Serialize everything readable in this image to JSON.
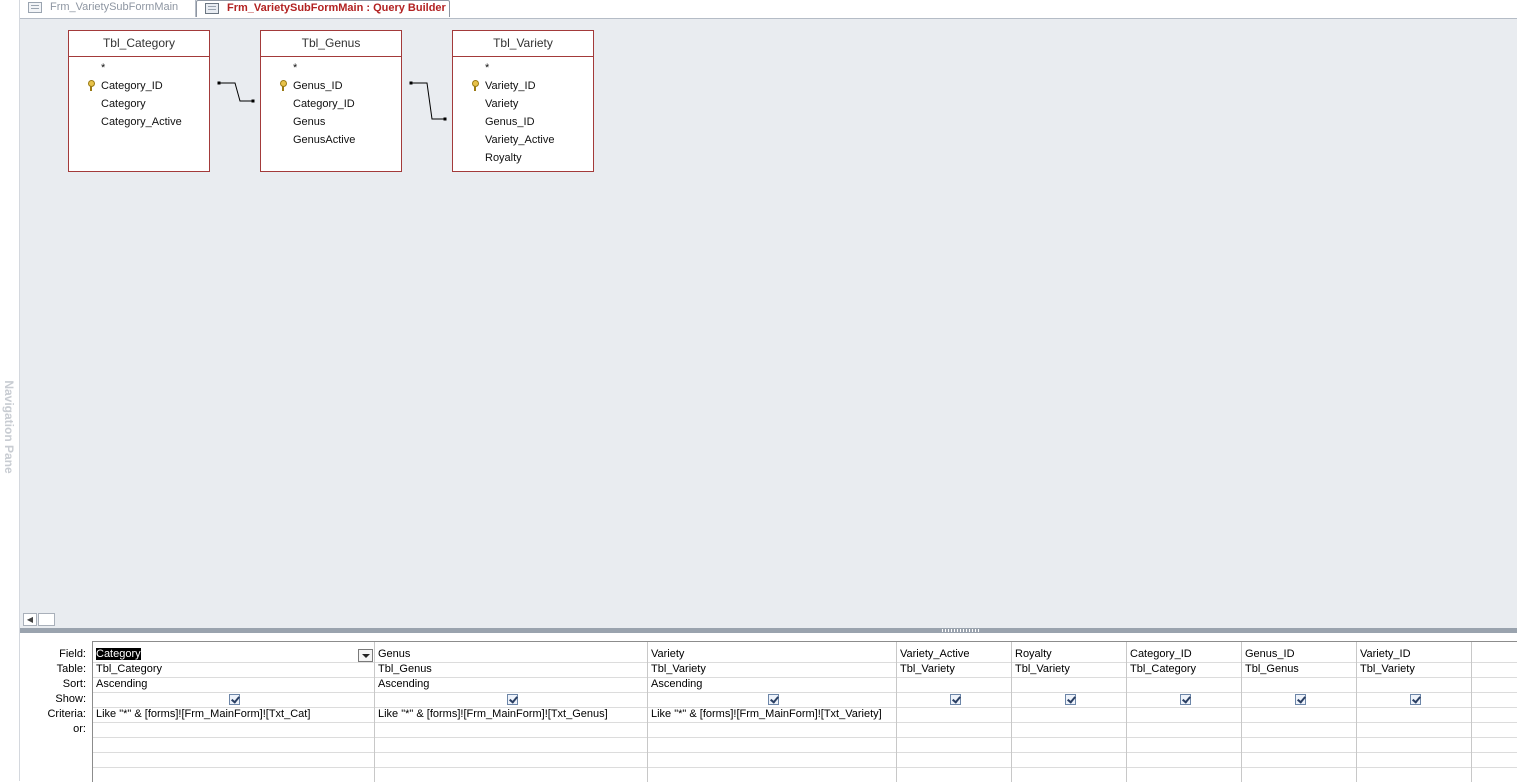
{
  "nav_pane": {
    "label": "Navigation Pane"
  },
  "tabs": [
    {
      "label": "Frm_VarietySubFormMain",
      "active": false
    },
    {
      "label": "Frm_VarietySubFormMain : Query Builder",
      "active": true
    }
  ],
  "tables": [
    {
      "name": "Tbl_Category",
      "fields": [
        "*",
        "Category_ID",
        "Category",
        "Category_Active"
      ],
      "key_field": "Category_ID"
    },
    {
      "name": "Tbl_Genus",
      "fields": [
        "*",
        "Genus_ID",
        "Category_ID",
        "Genus",
        "GenusActive"
      ],
      "key_field": "Genus_ID"
    },
    {
      "name": "Tbl_Variety",
      "fields": [
        "*",
        "Variety_ID",
        "Variety",
        "Genus_ID",
        "Variety_Active",
        "Royalty"
      ],
      "key_field": "Variety_ID"
    }
  ],
  "row_labels": [
    "Field:",
    "Table:",
    "Sort:",
    "Show:",
    "Criteria:",
    "or:"
  ],
  "columns": [
    {
      "field": "Category",
      "table": "Tbl_Category",
      "sort": "Ascending",
      "show": true,
      "criteria": "Like \"*\" & [forms]![Frm_MainForm]![Txt_Cat]"
    },
    {
      "field": "Genus",
      "table": "Tbl_Genus",
      "sort": "Ascending",
      "show": true,
      "criteria": "Like \"*\" & [forms]![Frm_MainForm]![Txt_Genus]"
    },
    {
      "field": "Variety",
      "table": "Tbl_Variety",
      "sort": "Ascending",
      "show": true,
      "criteria": "Like \"*\" & [forms]![Frm_MainForm]![Txt_Variety]"
    },
    {
      "field": "Variety_Active",
      "table": "Tbl_Variety",
      "sort": "",
      "show": true,
      "criteria": ""
    },
    {
      "field": "Royalty",
      "table": "Tbl_Variety",
      "sort": "",
      "show": true,
      "criteria": ""
    },
    {
      "field": "Category_ID",
      "table": "Tbl_Category",
      "sort": "",
      "show": true,
      "criteria": ""
    },
    {
      "field": "Genus_ID",
      "table": "Tbl_Genus",
      "sort": "",
      "show": true,
      "criteria": ""
    },
    {
      "field": "Variety_ID",
      "table": "Tbl_Variety",
      "sort": "",
      "show": true,
      "criteria": ""
    }
  ],
  "colors": {
    "table_border": "#a33a3a",
    "active_tab_text": "#b22222",
    "design_bg": "#e9ecf0"
  }
}
